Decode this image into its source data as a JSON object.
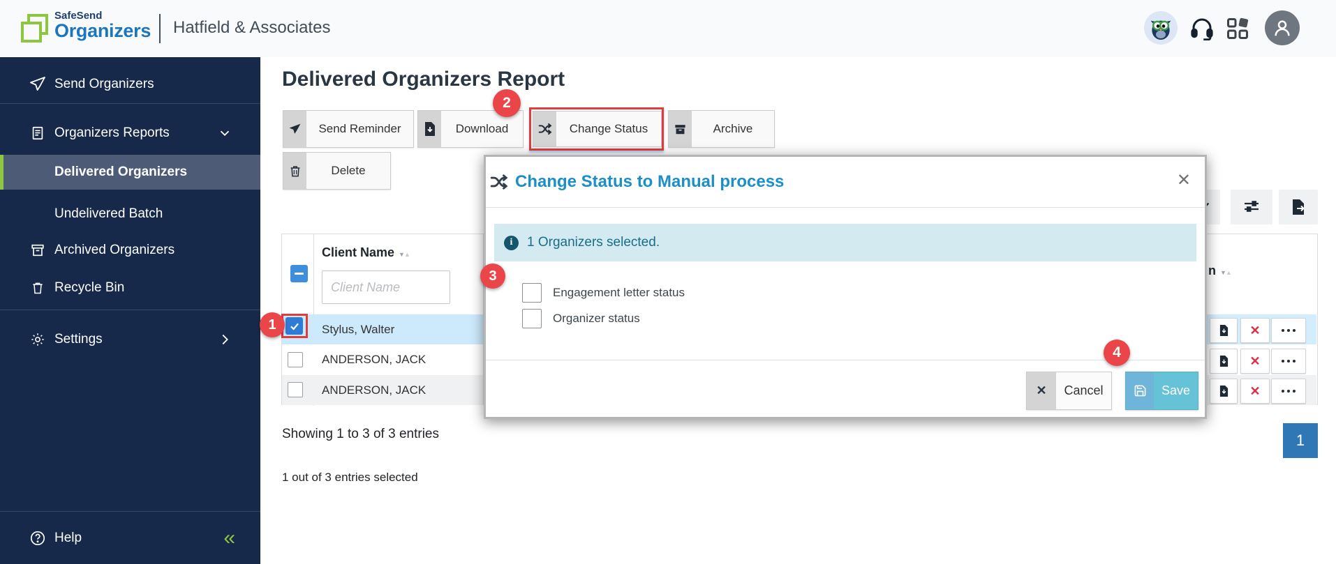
{
  "header": {
    "brand_top": "SafeSend",
    "brand_bottom": "Organizers",
    "firm_name": "Hatfield & Associates"
  },
  "sidebar": {
    "items": [
      {
        "label": "Send Organizers"
      },
      {
        "label": "Organizers Reports"
      },
      {
        "label": "Delivered Organizers"
      },
      {
        "label": "Undelivered Batch"
      },
      {
        "label": "Archived Organizers"
      },
      {
        "label": "Recycle Bin"
      },
      {
        "label": "Settings"
      }
    ],
    "help_label": "Help",
    "collapse_glyph": "«"
  },
  "main": {
    "title": "Delivered Organizers Report",
    "toolbar": {
      "send_reminder": "Send Reminder",
      "download": "Download",
      "change_status": "Change Status",
      "archive": "Archive",
      "delete": "Delete"
    },
    "table": {
      "client_name_header": "Client Name",
      "filter_placeholder": "Client Name",
      "partial_col_header": "n",
      "rows": [
        {
          "client_name": "Stylus, Walter",
          "selected": true
        },
        {
          "client_name": "ANDERSON, JACK",
          "selected": false
        },
        {
          "client_name": "ANDERSON, JACK",
          "selected": false
        }
      ]
    },
    "showing_text": "Showing 1 to 3 of 3 entries",
    "selected_text": "1 out of 3 entries selected",
    "pagination_page": "1"
  },
  "modal": {
    "title": "Change Status to Manual process",
    "close_glyph": "✕",
    "info_text": "1 Organizers selected.",
    "options": [
      {
        "label": "Engagement letter status"
      },
      {
        "label": "Organizer status"
      }
    ],
    "cancel_label": "Cancel",
    "save_label": "Save"
  },
  "badges": {
    "step1": "1",
    "step2": "2",
    "step3": "3",
    "step4": "4"
  },
  "colors": {
    "sidebar_navy": "#16294a",
    "active_item": "#4d5b77",
    "brand_green": "#8dc63f",
    "brand_blue": "#1b76bd",
    "badge_red": "#ea4649",
    "modal_title_blue": "#1b8fc6",
    "info_bg": "#d3eaf1",
    "info_text": "#186e86",
    "selected_row_blue": "#cdeafc",
    "checkbox_blue": "#2e7cd6",
    "save_teal": "#66c2d6",
    "pagination_blue": "#2f77b5"
  }
}
